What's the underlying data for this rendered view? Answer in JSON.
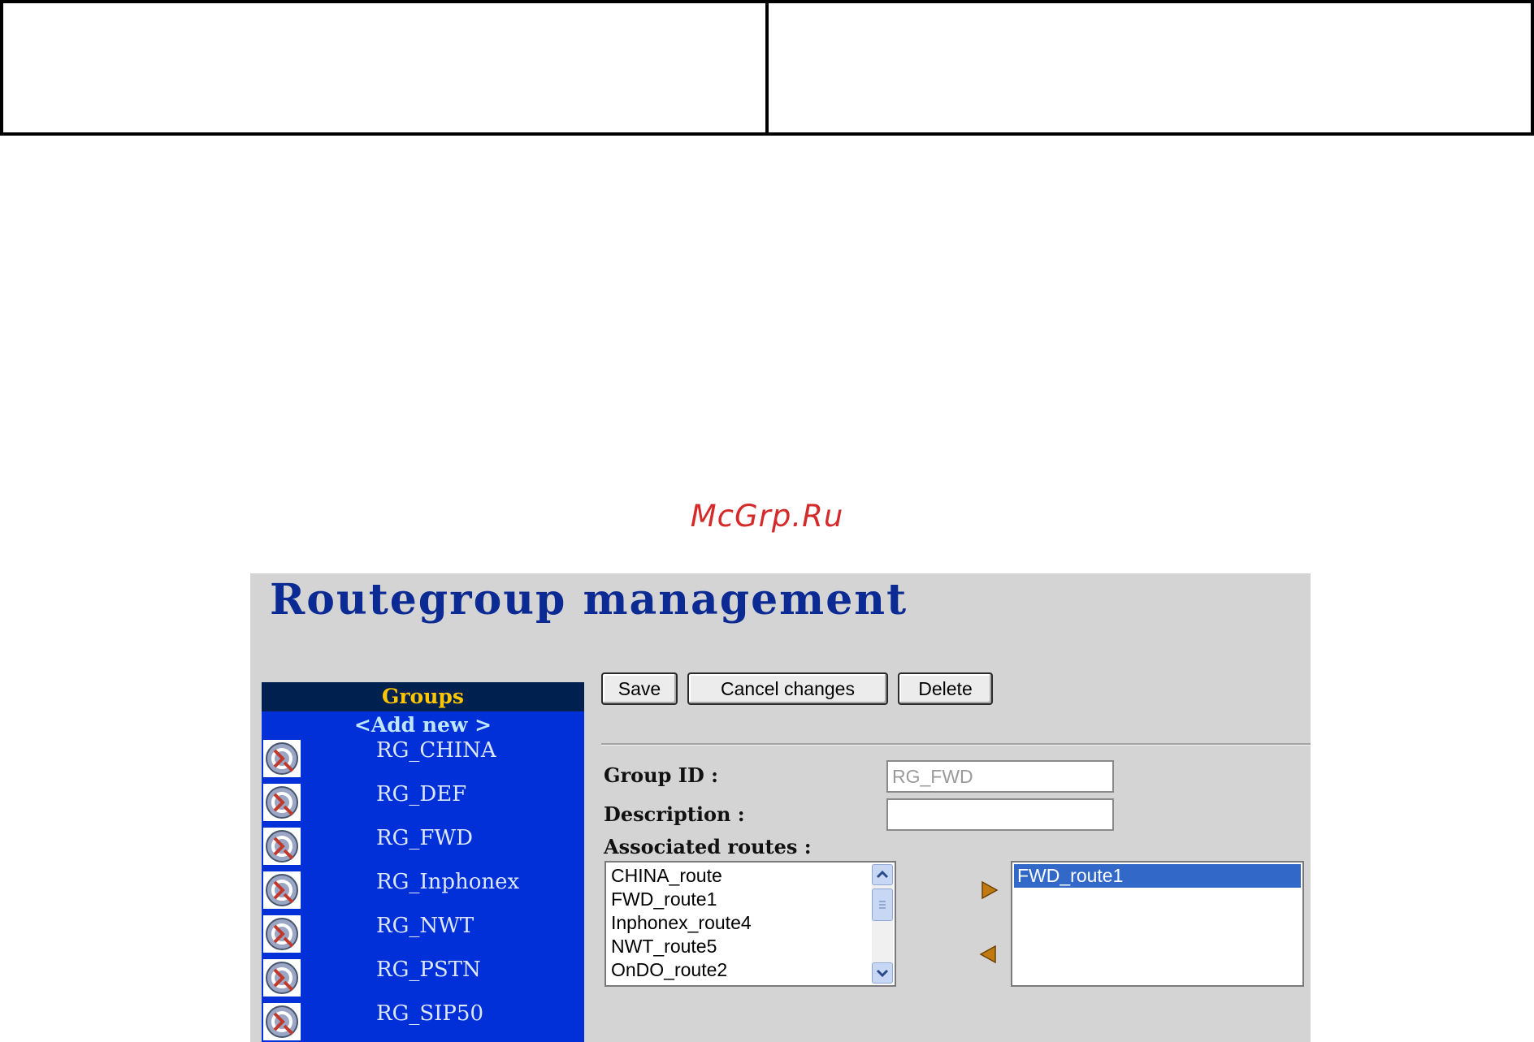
{
  "watermark": {
    "text": "McGrp.Ru",
    "color": "#d42a2a"
  },
  "page": {
    "title": "Routegroup management"
  },
  "groups": {
    "header": "Groups",
    "add_new": "<Add new >",
    "items": [
      {
        "label": "RG_CHINA",
        "icon": "route-group-icon"
      },
      {
        "label": "RG_DEF",
        "icon": "route-group-icon"
      },
      {
        "label": "RG_FWD",
        "icon": "route-group-icon"
      },
      {
        "label": "RG_Inphonex",
        "icon": "route-group-icon"
      },
      {
        "label": "RG_NWT",
        "icon": "route-group-icon"
      },
      {
        "label": "RG_PSTN",
        "icon": "route-group-icon"
      },
      {
        "label": "RG_SIP50",
        "icon": "route-group-icon"
      }
    ]
  },
  "toolbar": {
    "save_label": "Save",
    "cancel_label": "Cancel changes",
    "delete_label": "Delete"
  },
  "form": {
    "group_id_label": "Group  ID  :",
    "group_id_value": "RG_FWD",
    "description_label": "Description  :",
    "description_value": "",
    "associated_label": "Associated routes  :",
    "available_routes": [
      "CHINA_route",
      "FWD_route1",
      "Inphonex_route4",
      "NWT_route5",
      "OnDO_route2"
    ],
    "selected_routes": [
      "FWD_route1"
    ]
  },
  "icons": {
    "add": "arrow-right-icon",
    "remove": "arrow-left-icon"
  },
  "colors": {
    "title": "#0b2a94",
    "panel_bg": "#0230d8",
    "panel_header_bg": "#00214f",
    "panel_header_text": "#ffc600",
    "selection": "#3268c8"
  }
}
